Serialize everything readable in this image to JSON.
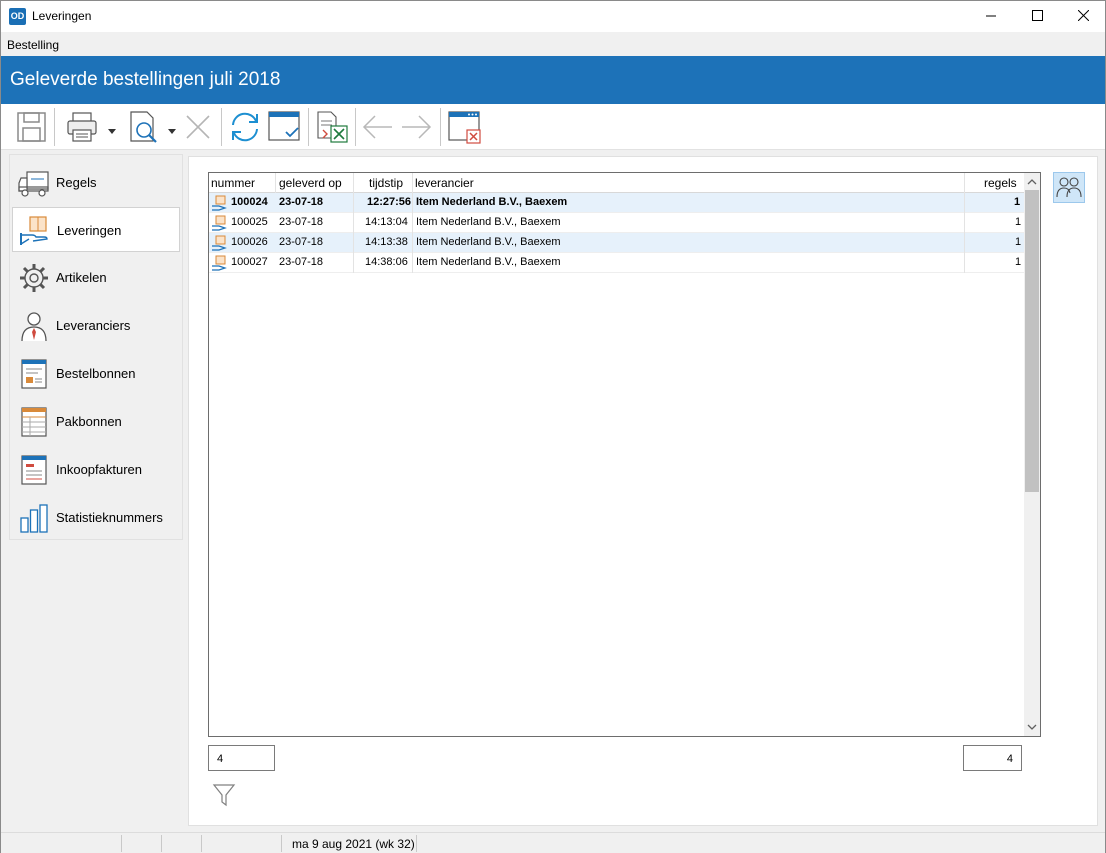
{
  "window": {
    "title": "Leveringen",
    "logo": "OD"
  },
  "menu": {
    "items": [
      "Bestelling"
    ]
  },
  "banner": {
    "title": "Geleverde bestellingen juli 2018"
  },
  "toolbar": {
    "icons": [
      "save-icon",
      "print-icon",
      "preview-icon",
      "delete-icon",
      "refresh-icon",
      "window-check-icon",
      "export-excel-icon",
      "arrow-left-icon",
      "arrow-right-icon",
      "close-window-icon"
    ]
  },
  "nav": {
    "items": [
      {
        "label": "Regels",
        "icon": "truck-icon"
      },
      {
        "label": "Leveringen",
        "icon": "delivery-hand-icon"
      },
      {
        "label": "Artikelen",
        "icon": "gear-icon"
      },
      {
        "label": "Leveranciers",
        "icon": "person-icon"
      },
      {
        "label": "Bestelbonnen",
        "icon": "order-form-icon"
      },
      {
        "label": "Pakbonnen",
        "icon": "packing-slip-icon"
      },
      {
        "label": "Inkoopfakturen",
        "icon": "invoice-icon"
      },
      {
        "label": "Statistieknummers",
        "icon": "bar-chart-icon"
      }
    ],
    "active": "Leveringen"
  },
  "grid": {
    "columns": {
      "nummer": "nummer",
      "geleverd_op": "geleverd op",
      "tijdstip": "tijdstip",
      "leverancier": "leverancier",
      "regels": "regels"
    },
    "rows": [
      {
        "nummer": "100024",
        "geleverd_op": "23-07-18",
        "tijdstip": "12:27:56",
        "leverancier": "Item Nederland B.V., Baexem",
        "regels": "1"
      },
      {
        "nummer": "100025",
        "geleverd_op": "23-07-18",
        "tijdstip": "14:13:04",
        "leverancier": "Item Nederland B.V., Baexem",
        "regels": "1"
      },
      {
        "nummer": "100026",
        "geleverd_op": "23-07-18",
        "tijdstip": "14:13:38",
        "leverancier": "Item Nederland B.V., Baexem",
        "regels": "1"
      },
      {
        "nummer": "100027",
        "geleverd_op": "23-07-18",
        "tijdstip": "14:38:06",
        "leverancier": "Item Nederland B.V., Baexem",
        "regels": "1"
      }
    ]
  },
  "counts": {
    "left": "4",
    "right": "4"
  },
  "status": {
    "date": "ma 9 aug 2021 (wk 32)"
  },
  "colors": {
    "banner": "#1d72b8",
    "row_alt": "#e6f1fb",
    "accent": "#1a6fb5"
  }
}
